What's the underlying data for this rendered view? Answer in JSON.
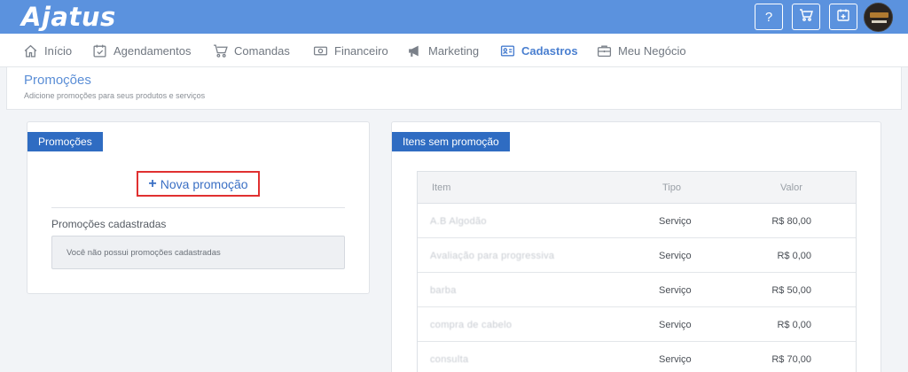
{
  "brand": {
    "logo_text": "Ajatus"
  },
  "topbar": {
    "help_label": "?",
    "accent_color": "#5b92de"
  },
  "nav": {
    "items": [
      {
        "label": "Início",
        "icon": "home-icon"
      },
      {
        "label": "Agendamentos",
        "icon": "calendar-check-icon"
      },
      {
        "label": "Comandas",
        "icon": "cart-icon"
      },
      {
        "label": "Financeiro",
        "icon": "money-icon"
      },
      {
        "label": "Marketing",
        "icon": "megaphone-icon"
      },
      {
        "label": "Cadastros",
        "icon": "id-card-icon",
        "active": true
      },
      {
        "label": "Meu Negócio",
        "icon": "briefcase-icon"
      }
    ]
  },
  "page": {
    "title": "Promoções",
    "subtitle": "Adicione promoções para seus produtos e serviços"
  },
  "promocoes_card": {
    "tab_label": "Promoções",
    "new_button_plus": "+",
    "new_button_label": "Nova promoção",
    "registered_label": "Promoções cadastradas",
    "empty_message": "Você não possui promoções cadastradas"
  },
  "itens_card": {
    "tab_label": "Itens sem promoção",
    "columns": {
      "item": "Item",
      "tipo": "Tipo",
      "valor": "Valor"
    },
    "rows": [
      {
        "item": "A.B Algodão",
        "tipo": "Serviço",
        "valor": "R$ 80,00"
      },
      {
        "item": "Avaliação para progressiva",
        "tipo": "Serviço",
        "valor": "R$ 0,00"
      },
      {
        "item": "barba",
        "tipo": "Serviço",
        "valor": "R$ 50,00"
      },
      {
        "item": "compra de cabelo",
        "tipo": "Serviço",
        "valor": "R$ 0,00"
      },
      {
        "item": "consulta",
        "tipo": "Serviço",
        "valor": "R$ 70,00"
      }
    ]
  }
}
